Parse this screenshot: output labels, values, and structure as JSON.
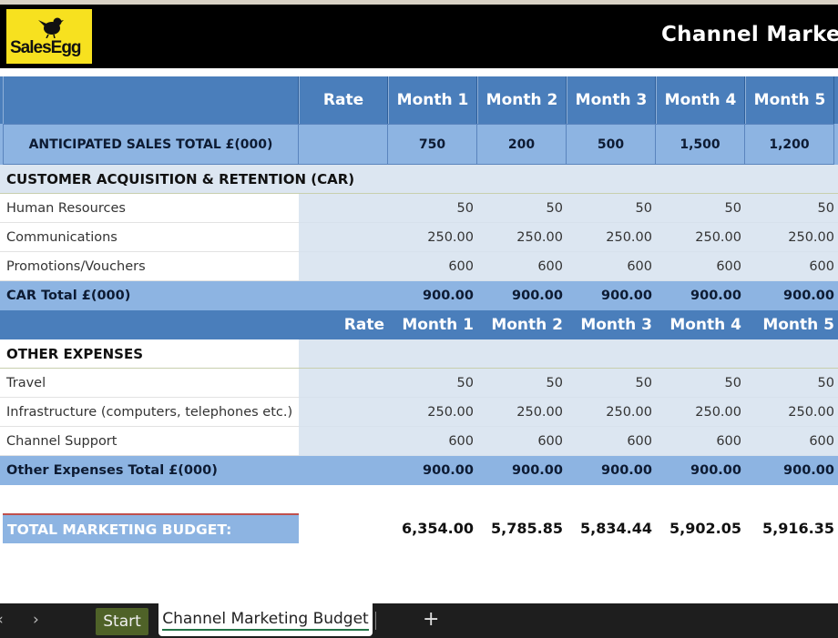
{
  "header": {
    "logo_text": "SalesEgg",
    "title": "Channel Marke"
  },
  "columns": {
    "rate": "Rate",
    "months": [
      "Month 1",
      "Month 2",
      "Month 3",
      "Month 4",
      "Month 5"
    ]
  },
  "sales": {
    "label": "ANTICIPATED SALES TOTAL £(000)",
    "values": [
      "750",
      "200",
      "500",
      "1,500",
      "1,200"
    ]
  },
  "car": {
    "title": "CUSTOMER ACQUISITION & RETENTION (CAR)",
    "rows": [
      {
        "label": "Human Resources",
        "values": [
          "50",
          "50",
          "50",
          "50",
          "50"
        ]
      },
      {
        "label": "Communications",
        "values": [
          "250.00",
          "250.00",
          "250.00",
          "250.00",
          "250.00"
        ]
      },
      {
        "label": "Promotions/Vouchers",
        "values": [
          "600",
          "600",
          "600",
          "600",
          "600"
        ]
      }
    ],
    "total_label": "CAR Total £(000)",
    "total_values": [
      "900.00",
      "900.00",
      "900.00",
      "900.00",
      "900.00"
    ]
  },
  "other": {
    "title": "OTHER EXPENSES",
    "rows": [
      {
        "label": "Travel",
        "values": [
          "50",
          "50",
          "50",
          "50",
          "50"
        ]
      },
      {
        "label": "Infrastructure (computers, telephones etc.)",
        "values": [
          "250.00",
          "250.00",
          "250.00",
          "250.00",
          "250.00"
        ]
      },
      {
        "label": "Channel Support",
        "values": [
          "600",
          "600",
          "600",
          "600",
          "600"
        ]
      }
    ],
    "total_label": "Other Expenses Total £(000)",
    "total_values": [
      "900.00",
      "900.00",
      "900.00",
      "900.00",
      "900.00"
    ]
  },
  "budget": {
    "label": "TOTAL MARKETING BUDGET:",
    "values": [
      "6,354.00",
      "5,785.85",
      "5,834.44",
      "5,902.05",
      "5,916.35"
    ]
  },
  "tabs": {
    "start": "Start",
    "active": "Channel Marketing Budget",
    "add": "+",
    "prev": "‹",
    "next": "›"
  },
  "colors": {
    "header_blue": "#4a7ebb",
    "light_blue": "#8db4e2",
    "tint": "#dce6f1",
    "logo_yellow": "#f7e11f",
    "start_tab": "#4f6228"
  }
}
